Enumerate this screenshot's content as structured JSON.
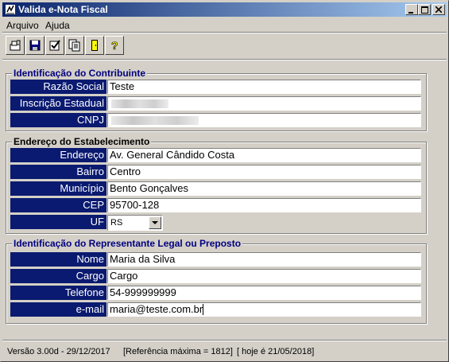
{
  "window": {
    "title": "Valida e-Nota Fiscal"
  },
  "menu": {
    "items": [
      "Arquivo",
      "Ajuda"
    ]
  },
  "toolbar": {
    "buttons": [
      "open-file-icon",
      "save-icon",
      "validate-check-icon",
      "copy-list-icon",
      "exit-door-icon",
      "help-question-icon"
    ]
  },
  "contribuinte": {
    "title": "Identificação do Contribuinte",
    "razao_social_label": "Razão Social",
    "razao_social_value": "Teste",
    "inscricao_label": "Inscrição Estadual",
    "cnpj_label": "CNPJ"
  },
  "endereco": {
    "title": "Endereço do Estabelecimento",
    "endereco_label": "Endereço",
    "endereco_value": "Av. General Cândido Costa",
    "bairro_label": "Bairro",
    "bairro_value": "Centro",
    "municipio_label": "Município",
    "municipio_value": "Bento Gonçalves",
    "cep_label": "CEP",
    "cep_value": "95700-128",
    "uf_label": "UF",
    "uf_value": "RS"
  },
  "representante": {
    "title": "Identificação do Representante Legal ou Preposto",
    "nome_label": "Nome",
    "nome_value": "Maria da Silva",
    "cargo_label": "Cargo",
    "cargo_value": "Cargo",
    "telefone_label": "Telefone",
    "telefone_value": "54-999999999",
    "email_label": "e-mail",
    "email_value": "maria@teste.com.br"
  },
  "status": {
    "version": "Versão 3.00d - 29/12/2017",
    "reference": "[Referência máxima = 1812]",
    "today": "[ hoje é 21/05/2018]"
  }
}
